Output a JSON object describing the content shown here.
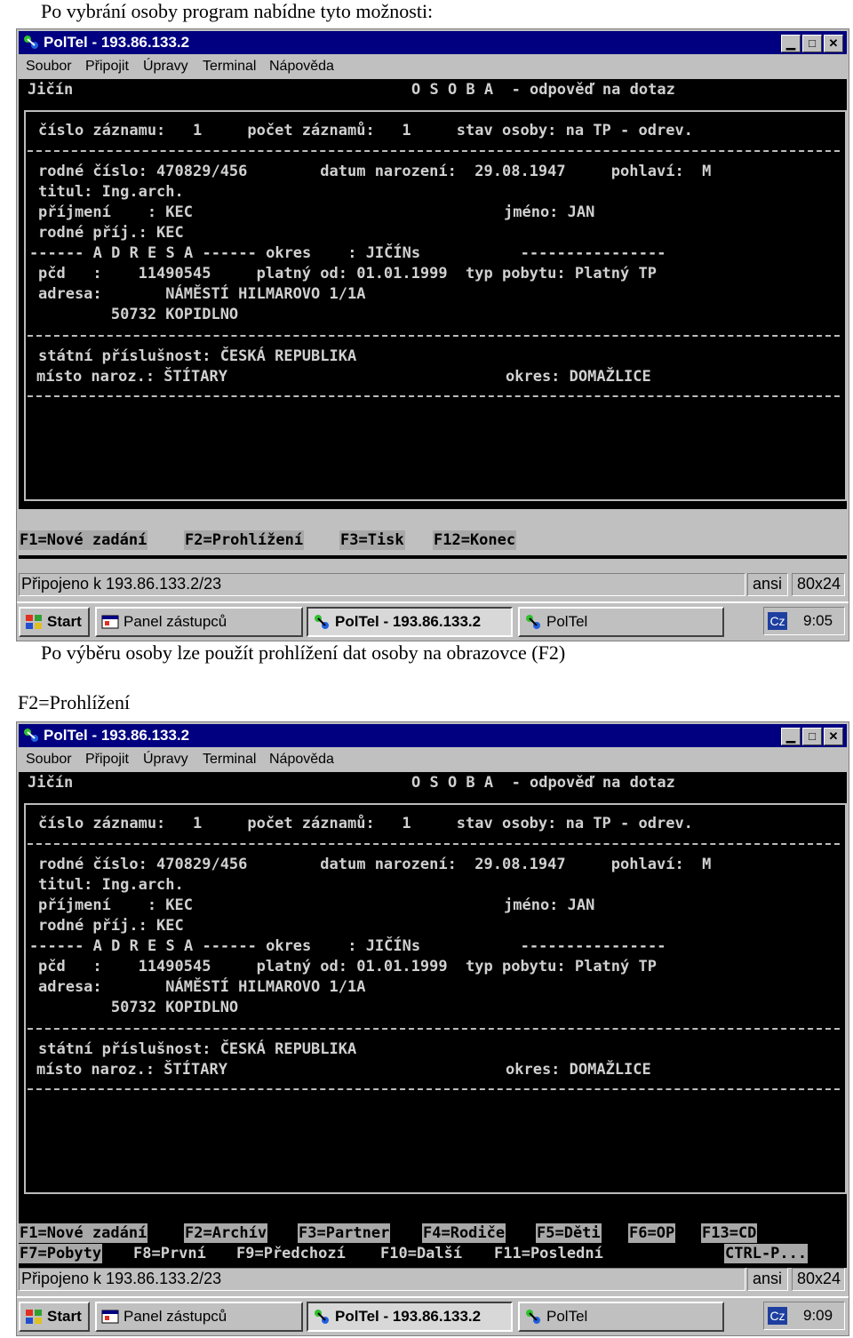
{
  "caption_top": "Po vybrání osoby program nabídne tyto možnosti:",
  "caption_mid": "Po výběru osoby lze použít prohlížení dat osoby na obrazovce (F2)",
  "caption_f2": "F2=Prohlížení",
  "window": {
    "title": "PolTel - 193.86.133.2",
    "menu": [
      "Soubor",
      "Připojit",
      "Úpravy",
      "Terminal",
      "Nápověda"
    ]
  },
  "terminal": {
    "header_left": "Jičín",
    "header_right": "O S O B A  - odpověď na dotaz",
    "line_record": "číslo záznamu:   1     počet záznamů:   1     stav osoby: na TP - odrev.",
    "line_rc": "rodné číslo: 470829/456        datum narození:  29.08.1947     pohlaví:  M",
    "line_titul": "titul: Ing.arch.",
    "line_prijmeni_left": "příjmení    : KEC",
    "line_prijmeni_right": "jméno: JAN",
    "line_rodne": "rodné příj.: KEC",
    "line_adresa_hdr": "------ A D R E S A ------ okres    : JIČÍNs           ----------------",
    "line_pcd": "pčd   :    11490545     platný od: 01.01.1999  typ pobytu: Platný TP",
    "line_adresa": "adresa:       NÁMĚSTÍ HILMAROVO 1/1A",
    "line_psc": "        50732 KOPIDLNO",
    "line_statni": "státní příslušnost: ČESKÁ REPUBLIKA",
    "line_misto_left": "místo naroz.: ŠTÍTARY",
    "line_misto_right": "okres: DOMAŽLICE"
  },
  "fkeys1": [
    "F1=Nové zadání",
    "F2=Prohlížení",
    "F3=Tisk",
    "F12=Konec"
  ],
  "fkeys2_row1": [
    "F1=Nové zadání",
    "F2=Archív",
    "F3=Partner",
    "F4=Rodiče",
    "F5=Děti",
    "F6=OP",
    "F13=CD"
  ],
  "fkeys2_row2": [
    "F7=Pobyty",
    "F8=První",
    "F9=Předchozí",
    "F10=Další",
    "F11=Poslední",
    "CTRL-P..."
  ],
  "status": {
    "connected": "Připojeno k 193.86.133.2/23",
    "mode": "ansi",
    "size": "80x24"
  },
  "taskbar": {
    "start": "Start",
    "items": [
      "Panel zástupců",
      "PolTel - 193.86.133.2",
      "PolTel"
    ],
    "lang": "Cz",
    "clock1": "9:05",
    "clock2": "9:09"
  },
  "colors": {
    "titlebar": "#000080",
    "terminal_bg": "#000000",
    "terminal_fg": "#d0d0d0",
    "fkey_bg": "#a8a8a8",
    "window_bg": "#c0c0c0"
  }
}
